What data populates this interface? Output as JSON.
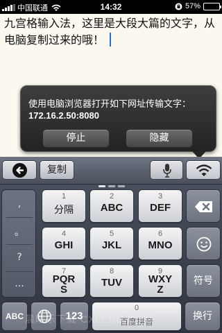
{
  "status_bar": {
    "carrier": "中国联通",
    "time": "14:32",
    "battery_percent": "57%",
    "battery_level": 0.57,
    "signal_bars": 4
  },
  "note": {
    "text": "九宫格输入法，这里是大段大篇的文字，从电脑复制过来的哦！"
  },
  "popup": {
    "message": "使用电脑浏览器打开如下网址传输文字：",
    "url": "172.16.2.50:8080",
    "stop_label": "停止",
    "hide_label": "隐藏"
  },
  "toolbar": {
    "back_icon": "back-arrow-icon",
    "copy_label": "复制",
    "mic_icon": "microphone-icon",
    "wifi_icon": "wifi-icon"
  },
  "punctuation": [
    ",",
    "。",
    "?",
    "..."
  ],
  "keys": [
    {
      "num": "1",
      "label": "分隔"
    },
    {
      "num": "2",
      "label": "ABC"
    },
    {
      "num": "3",
      "label": "DEF"
    },
    {
      "num": "4",
      "label": "GHI"
    },
    {
      "num": "5",
      "label": "JKL"
    },
    {
      "num": "6",
      "label": "MNO"
    },
    {
      "num": "7",
      "label": "PQRS"
    },
    {
      "num": "8",
      "label": "TUV"
    },
    {
      "num": "9",
      "label": "WXYZ"
    }
  ],
  "side_keys": {
    "delete_icon": "delete-icon",
    "emoji_icon": "smiley-icon",
    "symbol_label": "符号"
  },
  "bottom_row": {
    "abc_label": "ABC",
    "globe_icon": "globe-icon",
    "num_label": "123",
    "space_num": "0",
    "space_label": "百度拼音",
    "enter_label": "换行"
  },
  "watermark": "晨曦乐下载 CXLEDU.COM",
  "colors": {
    "popup_bg": "#2b2b2b",
    "keyboard_bg": "#3d4450",
    "caret": "#2a6cd6",
    "note_bg": "#fbf9ef"
  }
}
